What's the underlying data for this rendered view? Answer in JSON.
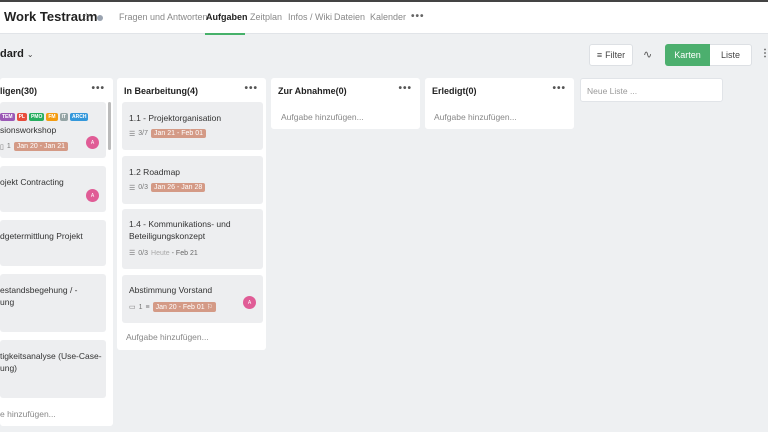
{
  "workspace": {
    "title": "Work Testraum"
  },
  "tabs": [
    {
      "label": "Fragen und Antworten"
    },
    {
      "label": "Aufgaben"
    },
    {
      "label": "Zeitplan"
    },
    {
      "label": "Infos / Wiki"
    },
    {
      "label": "Dateien"
    },
    {
      "label": "Kalender"
    }
  ],
  "toolbar": {
    "board": "dard",
    "filter": "Filter",
    "view_cards": "Karten",
    "view_list": "Liste"
  },
  "columns": [
    {
      "title": "ligen(30)",
      "cards": [
        {
          "tags": [
            "TEM",
            "PL",
            "PMO",
            "FM",
            "IT",
            "ARCH"
          ],
          "title": "sionsworkshop",
          "comments": "1",
          "date": "Jan 20 - Jan 21",
          "avatar": "A"
        },
        {
          "title": "ojekt Contracting",
          "avatar": "A"
        },
        {
          "title": "dgetermittlung Projekt"
        },
        {
          "title_lines": [
            "estandsbegehung / -",
            "ung"
          ]
        },
        {
          "title_lines": [
            "tigkeitsanalyse (Use-Case-",
            "ung)"
          ]
        }
      ],
      "add_task": "e hinzufügen..."
    },
    {
      "title": "In Bearbeitung(4)",
      "cards": [
        {
          "title": "1.1 - Projektorganisation",
          "checklist": "3/7",
          "date": "Jan 21 - Feb 01"
        },
        {
          "title": "1.2 Roadmap",
          "checklist": "0/3",
          "date": "Jan 26 - Jan 28"
        },
        {
          "title_lines": [
            "1.4 - Kommunikations- und",
            "Beteiligungskonzept"
          ],
          "checklist": "0/3",
          "date_today": "Heute",
          "date_end": "- Feb 21"
        },
        {
          "title": "Abstimmung Vorstand",
          "comments": "1",
          "date": "Jan 20 - Feb 01",
          "avatar": "A"
        }
      ],
      "add_task": "Aufgabe hinzufügen..."
    },
    {
      "title": "Zur Abnahme(0)",
      "add_task": "Aufgabe hinzufügen..."
    },
    {
      "title": "Erledigt(0)",
      "add_task": "Aufgabe hinzufügen..."
    }
  ],
  "new_list": {
    "placeholder": "Neue Liste ..."
  },
  "icons": {
    "star": "star-icon",
    "filter": "filter-icon",
    "activity": "activity-icon",
    "more": "more-icon"
  },
  "colors": {
    "accent": "#46b16a",
    "date_badge": "#d49a86",
    "avatar": "#e05c96",
    "tags": [
      "#9b59b6",
      "#e74c3c",
      "#27ae60",
      "#f39c12",
      "#95a5a6",
      "#3498db"
    ]
  }
}
